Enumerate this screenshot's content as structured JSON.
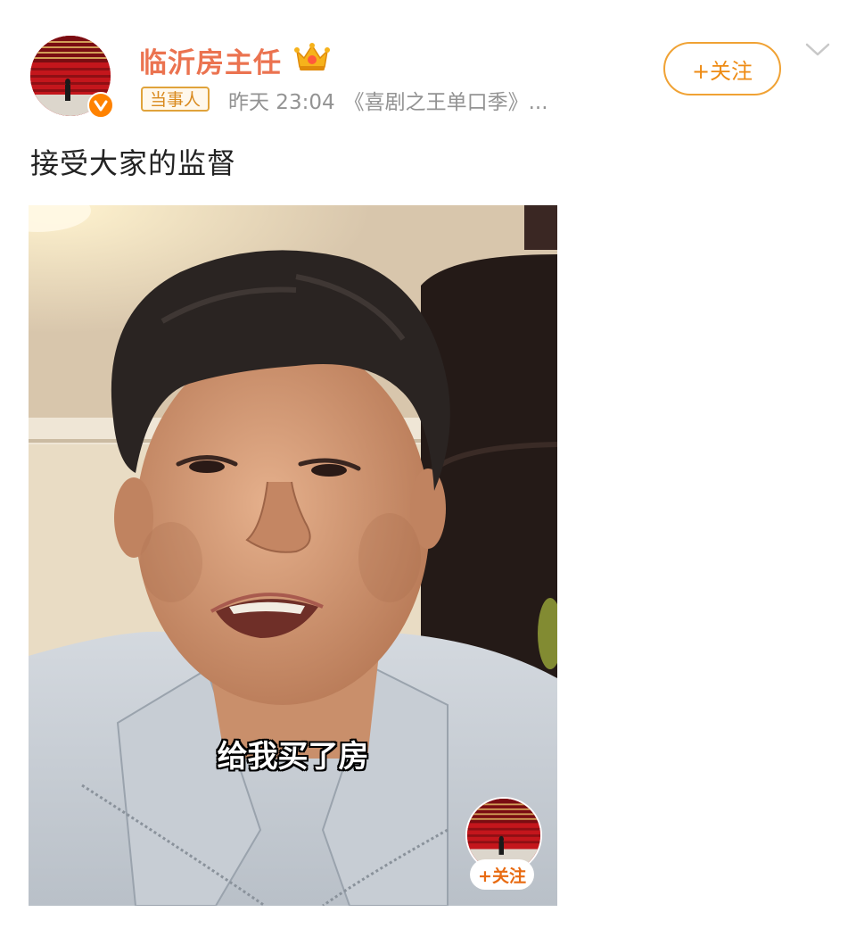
{
  "post": {
    "author": {
      "name": "临沂房主任",
      "role_tag": "当事人"
    },
    "meta": {
      "time": "昨天 23:04",
      "source": "《喜剧之王单口季》..."
    },
    "follow_label": "+关注",
    "text": "接受大家的监督"
  },
  "video": {
    "subtitle": "给我买了房",
    "overlay_follow_label": "+关注"
  },
  "colors": {
    "username": "#eb7350",
    "accent_orange": "#ff8200",
    "follow_border": "#f0a234",
    "meta_gray": "#939393"
  }
}
